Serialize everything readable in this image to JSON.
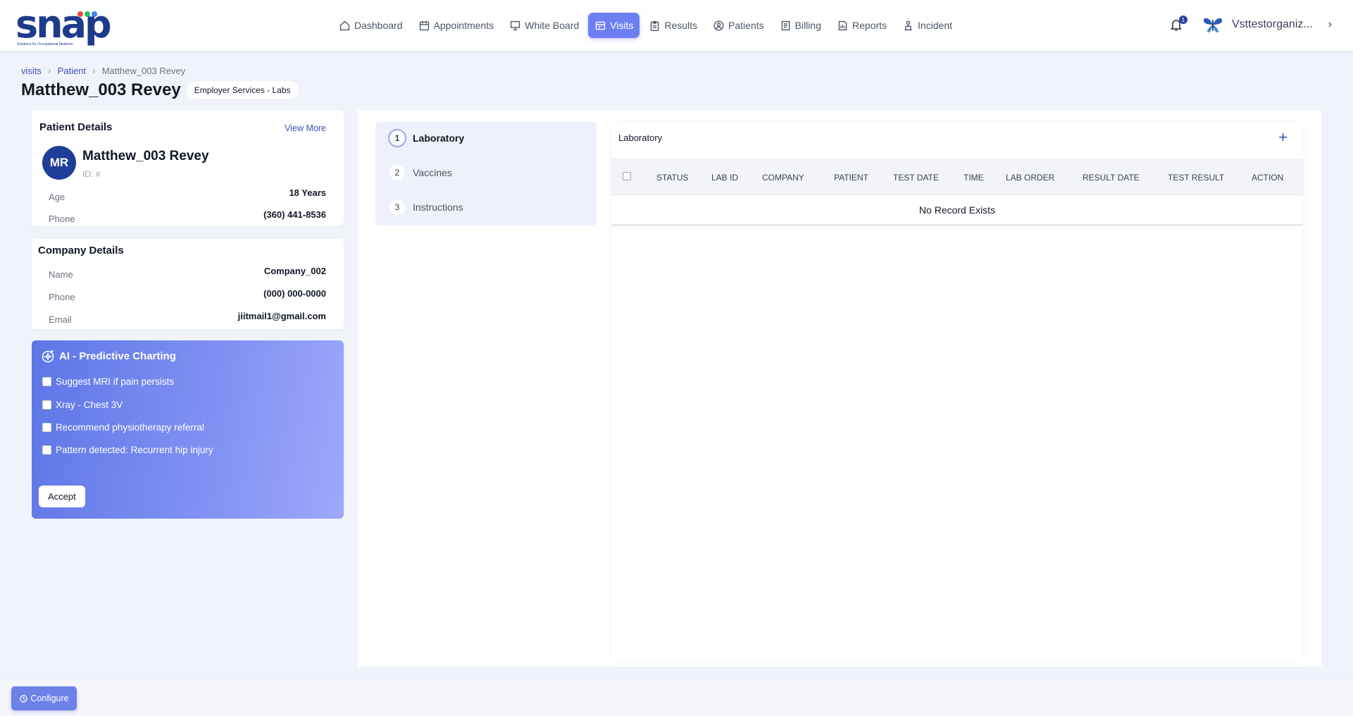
{
  "app": {
    "logo_text": "snap",
    "logo_tagline": "Solutions for Occupational Medicine"
  },
  "nav": [
    {
      "label": "Dashboard",
      "icon": "home-icon"
    },
    {
      "label": "Appointments",
      "icon": "calendar-icon"
    },
    {
      "label": "White Board",
      "icon": "whiteboard-icon"
    },
    {
      "label": "Visits",
      "icon": "visits-icon",
      "active": true
    },
    {
      "label": "Results",
      "icon": "clipboard-icon"
    },
    {
      "label": "Patients",
      "icon": "patient-icon"
    },
    {
      "label": "Billing",
      "icon": "billing-icon"
    },
    {
      "label": "Reports",
      "icon": "reports-icon"
    },
    {
      "label": "Incident",
      "icon": "incident-icon"
    }
  ],
  "notifications": {
    "count": "1"
  },
  "org": {
    "name": "Vsttestorganiz..."
  },
  "breadcrumb": {
    "visits": "visits",
    "patient": "Patient",
    "current": "Matthew_003 Revey"
  },
  "page": {
    "title": "Matthew_003 Revey",
    "service_badge": "Employer Services - Labs"
  },
  "patient_details": {
    "heading": "Patient Details",
    "view_more": "View More",
    "initials": "MR",
    "name": "Matthew_003 Revey",
    "id": "ID: #",
    "age_label": "Age",
    "age": "18 Years",
    "phone_label": "Phone",
    "phone": "(360) 441-8536"
  },
  "company_details": {
    "heading": "Company Details",
    "name_label": "Name",
    "name": "Company_002",
    "phone_label": "Phone",
    "phone": "(000) 000-0000",
    "email_label": "Email",
    "email": "jiitmail1@gmail.com"
  },
  "ai": {
    "heading": "AI - Predictive Charting",
    "options": [
      "Suggest MRI if pain persists",
      "Xray - Chest 3V",
      "Recommend physiotherapy referral",
      "Pattern detected: Recurrent hip injury"
    ],
    "accept": "Accept"
  },
  "steps": [
    {
      "num": "1",
      "label": "Laboratory"
    },
    {
      "num": "2",
      "label": "Vaccines"
    },
    {
      "num": "3",
      "label": "Instructions"
    }
  ],
  "lab": {
    "heading": "Laboratory",
    "add": "+",
    "columns": [
      "STATUS",
      "LAB ID",
      "COMPANY",
      "PATIENT",
      "TEST DATE",
      "TIME",
      "LAB ORDER",
      "RESULT DATE",
      "TEST RESULT",
      "ACTION"
    ],
    "empty": "No Record Exists"
  },
  "footer": {
    "configure": "Configure"
  },
  "colors": {
    "accent": "#6d7ff0",
    "brand": "#1e3a8a",
    "avatar": "#1f3e9a"
  }
}
